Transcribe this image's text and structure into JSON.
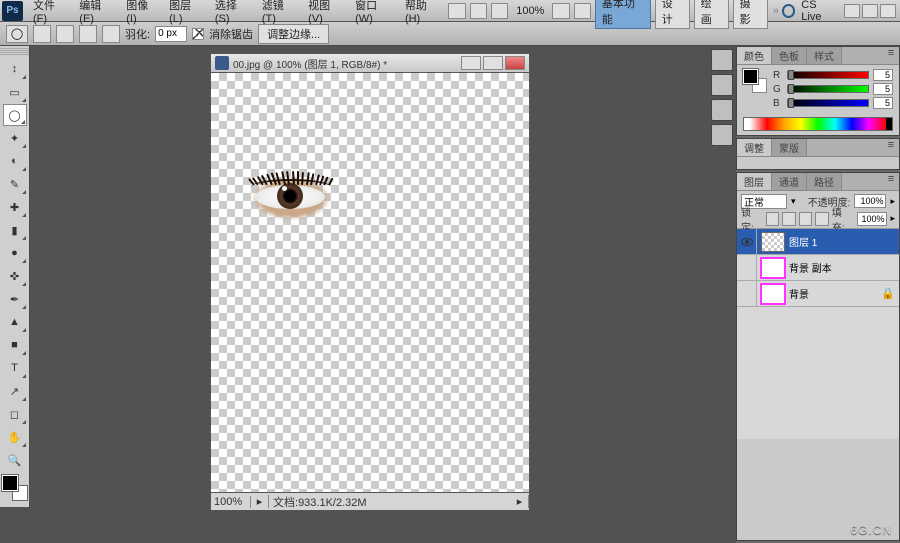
{
  "app": {
    "logo": "Ps"
  },
  "menu": {
    "items": [
      "文件(F)",
      "编辑(E)",
      "图像(I)",
      "图层(L)",
      "选择(S)",
      "滤镜(T)",
      "视图(V)",
      "窗口(W)",
      "帮助(H)"
    ]
  },
  "top_toolbar": {
    "zoom_pct": "100%",
    "workspaces": [
      "基本功能",
      "设计",
      "绘画",
      "摄影"
    ],
    "active_workspace": 0,
    "more": "»",
    "cslive": "CS Live"
  },
  "options": {
    "feather_label": "羽化:",
    "feather_value": "0 px",
    "antialias_checked": true,
    "antialias_label": "消除锯齿",
    "refine_btn": "调整边缘..."
  },
  "tools": {
    "glyphs": [
      "↕",
      "▭",
      "◯",
      "✦",
      "◐",
      "✎",
      "✚",
      "▮",
      "●",
      "✜",
      "✒",
      "▲",
      "■",
      "T",
      "↗",
      "◻",
      "✋",
      "🔍"
    ]
  },
  "document": {
    "title": "00.jpg @ 100% (图层 1, RGB/8#) *",
    "zoom": "100%",
    "status_prefix": "文档:",
    "status_size": "933.1K/2.32M"
  },
  "panels": {
    "color": {
      "tabs": [
        "颜色",
        "色板",
        "样式"
      ],
      "active": 0,
      "channels": [
        {
          "label": "R",
          "value": "5"
        },
        {
          "label": "G",
          "value": "5"
        },
        {
          "label": "B",
          "value": "5"
        }
      ]
    },
    "adjust": {
      "tabs": [
        "调整",
        "蒙版"
      ],
      "active": 0
    },
    "layers": {
      "tabs": [
        "图层",
        "通道",
        "路径"
      ],
      "active": 0,
      "blend_mode": "正常",
      "opacity_label": "不透明度:",
      "opacity_value": "100%",
      "lock_label": "锁定:",
      "fill_label": "填充:",
      "fill_value": "100%",
      "rows": [
        {
          "visible": true,
          "name": "图层 1",
          "selected": true,
          "hidden": false,
          "locked": false
        },
        {
          "visible": false,
          "name": "背景 副本",
          "selected": false,
          "hidden": true,
          "locked": false
        },
        {
          "visible": false,
          "name": "背景",
          "selected": false,
          "hidden": true,
          "locked": true
        }
      ]
    }
  },
  "watermark": "6G.CN"
}
